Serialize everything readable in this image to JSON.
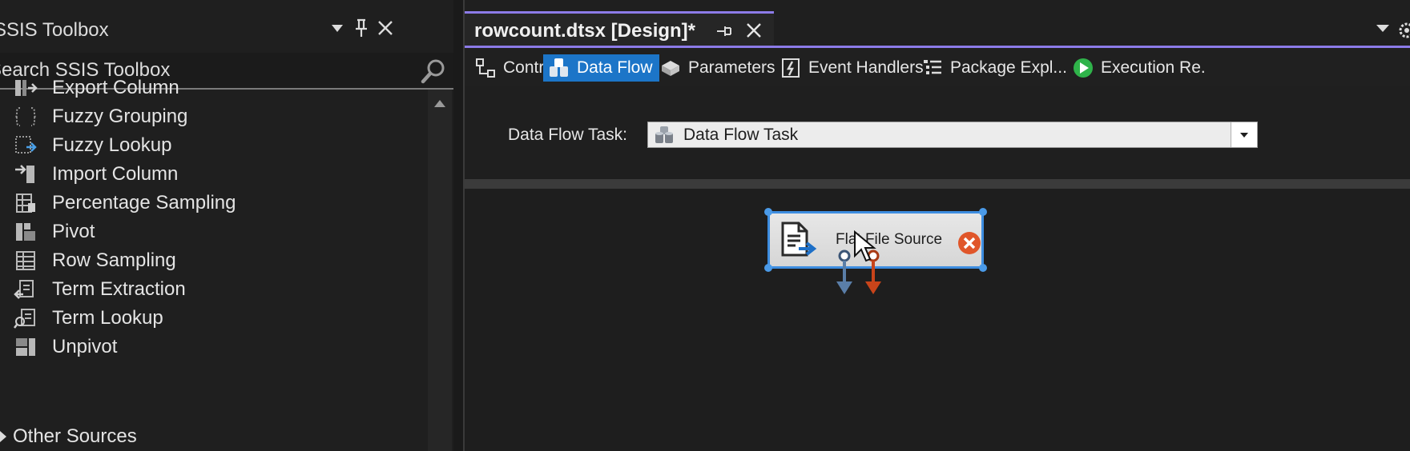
{
  "toolbox": {
    "title": "SSIS Toolbox",
    "search_placeholder": "Search SSIS Toolbox",
    "items": [
      {
        "label": "Export Column",
        "icon": "export-column-icon"
      },
      {
        "label": "Fuzzy Grouping",
        "icon": "fuzzy-grouping-icon"
      },
      {
        "label": "Fuzzy Lookup",
        "icon": "fuzzy-lookup-icon"
      },
      {
        "label": "Import Column",
        "icon": "import-column-icon"
      },
      {
        "label": "Percentage Sampling",
        "icon": "percentage-sampling-icon"
      },
      {
        "label": "Pivot",
        "icon": "pivot-icon"
      },
      {
        "label": "Row Sampling",
        "icon": "row-sampling-icon"
      },
      {
        "label": "Term Extraction",
        "icon": "term-extraction-icon"
      },
      {
        "label": "Term Lookup",
        "icon": "term-lookup-icon"
      },
      {
        "label": "Unpivot",
        "icon": "unpivot-icon"
      }
    ],
    "group_other": "Other Sources"
  },
  "document": {
    "tab_title": "rowcount.dtsx [Design]*",
    "designer_tabs": [
      {
        "label": "Control Flow",
        "icon": "control-flow-icon",
        "active": false
      },
      {
        "label": "Data Flow",
        "icon": "data-flow-icon",
        "active": true
      },
      {
        "label": "Parameters",
        "icon": "parameters-icon",
        "active": false
      },
      {
        "label": "Event Handlers",
        "icon": "event-handlers-icon",
        "active": false
      },
      {
        "label": "Package Expl...",
        "icon": "package-explorer-icon",
        "active": false
      },
      {
        "label": "Execution Re.",
        "icon": "execution-results-icon",
        "active": false
      }
    ],
    "task_label": "Data Flow Task:",
    "task_value": "Data Flow Task"
  },
  "canvas": {
    "component_label": "Flat File Source",
    "component_status": "error"
  },
  "colors": {
    "accent": "#8c7be8",
    "active_tab": "#1c75c8",
    "selection": "#3d8de0",
    "error": "#e0562a",
    "success": "#2fb34a"
  }
}
